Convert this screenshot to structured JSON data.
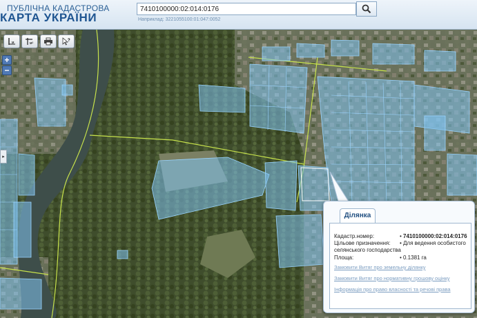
{
  "header": {
    "logo_line1": "ПУБЛІЧНА КАДАСТРОВА",
    "logo_line2": "КАРТА УКРАЇНИ"
  },
  "search": {
    "value": "7410100000:02:014:0176",
    "example": "Наприклад: 3221055100:01:047:0052"
  },
  "toolbar": {
    "buttons": [
      "ruler-length-icon",
      "ruler-area-icon",
      "print-icon",
      "help-cursor-icon"
    ],
    "zoom_in": "+",
    "zoom_out": "−",
    "side_handle": "▸"
  },
  "popup": {
    "tab": "Ділянка",
    "fields": [
      {
        "label": "Кадастр.номер:",
        "value": "7410100000:02:014:0176"
      },
      {
        "label": "Цільове призначення:",
        "value": "Для ведення особистого селянського господарства"
      },
      {
        "label": "Площа:",
        "value": "0.1381 га"
      }
    ],
    "links": [
      "Замовити Витяг про земельну ділянку",
      "Замовити Витяг про нормативну грошову оцінку",
      "Інформація про право власності та речові права"
    ]
  },
  "colors": {
    "parcel_fill": "#7fc3f0",
    "parcel_stroke": "#9ad4ff",
    "boundary": "#c8e34b",
    "river": "#3e4e4a",
    "link": "#7a9cc0"
  }
}
